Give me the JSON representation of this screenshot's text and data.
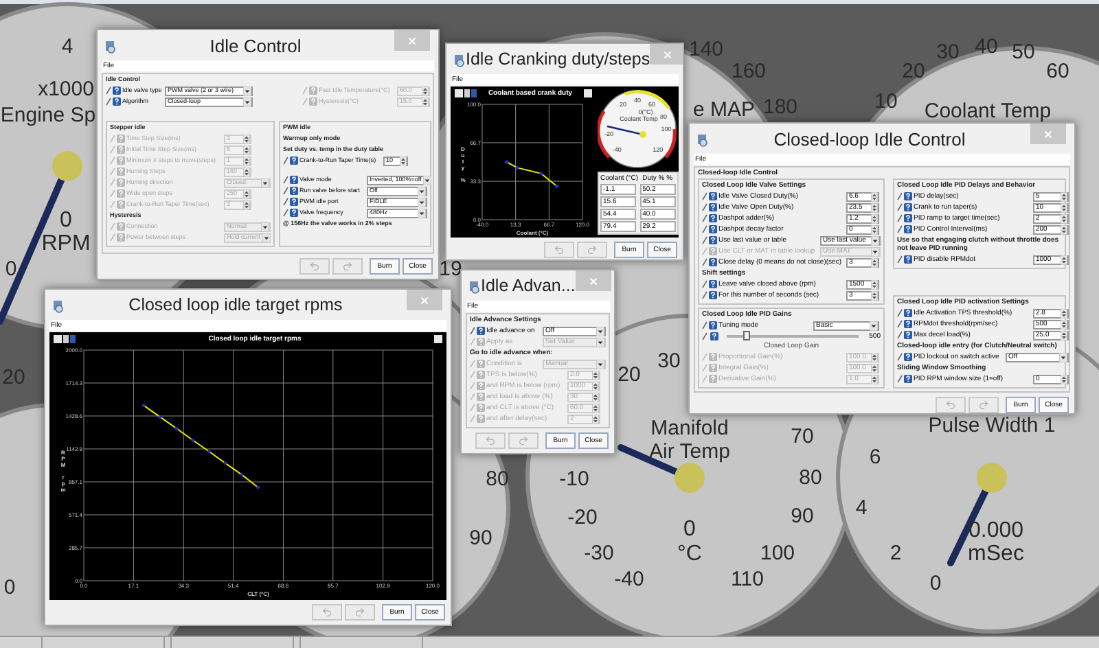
{
  "gauges": [
    {
      "title_lines": [
        "x1000",
        "Engine Sp"
      ],
      "ticks": [
        "4",
        "0"
      ],
      "reading": "0",
      "unit": "RPM"
    },
    {
      "title_lines": [
        "e MAP"
      ],
      "ticks": [
        "140",
        "160",
        "180"
      ]
    },
    {
      "title_lines": [
        "Coolant Temp"
      ],
      "ticks": [
        "10",
        "20",
        "30",
        "40",
        "50",
        "60"
      ]
    },
    {
      "ticks": [
        "19"
      ]
    },
    {
      "ticks": [
        "20",
        "0"
      ]
    },
    {
      "ticks": [
        "80",
        "90"
      ]
    },
    {
      "title_lines": [
        "Manifold",
        "Air Temp"
      ],
      "ticks": [
        "20",
        "30",
        "-10",
        "-20",
        "-30",
        "-40",
        "70",
        "80",
        "90",
        "100",
        "110"
      ],
      "reading": "0",
      "unit": "°C"
    },
    {
      "title_lines": [
        "Pulse Width 1"
      ],
      "ticks": [
        "6",
        "4",
        "2",
        "0"
      ],
      "reading": "0.000",
      "unit": "mSec"
    }
  ],
  "idle_control": {
    "title": "Idle Control",
    "menu": "File",
    "group": "Idle Control",
    "top_left": [
      {
        "kind": "select",
        "label": "Idle valve type",
        "value": "PWM valve (2 or 3 wire)",
        "disabled": false
      },
      {
        "kind": "select",
        "label": "Algorithm",
        "value": "Closed-loop",
        "disabled": false
      }
    ],
    "top_right": [
      {
        "kind": "field",
        "label": "Fast Idle Temperature(°C)",
        "value": "60.0",
        "disabled": true
      },
      {
        "kind": "field",
        "label": "Hysteresis(°C)",
        "value": "15.0",
        "disabled": true
      }
    ],
    "stepper": {
      "title": "Stepper idle",
      "rows": [
        {
          "kind": "field",
          "label": "Time Step Size(ms)",
          "value": "3",
          "disabled": true
        },
        {
          "kind": "field",
          "label": "Initial Time Step Size(ms)",
          "value": "5",
          "disabled": true
        },
        {
          "kind": "field",
          "label": "Minimum # steps to move(steps)",
          "value": "1",
          "disabled": true
        },
        {
          "kind": "field",
          "label": "Homing Steps",
          "value": "160",
          "disabled": true
        },
        {
          "kind": "select",
          "label": "Homing direction",
          "value": "Closed",
          "disabled": true
        },
        {
          "kind": "field",
          "label": "Wide open steps",
          "value": "250",
          "disabled": true
        },
        {
          "kind": "field",
          "label": "Crank-to-Run Taper Time(sec)",
          "value": "3",
          "disabled": true
        },
        {
          "kind": "heading",
          "label": "Hysteresis"
        },
        {
          "kind": "select",
          "label": "Connection",
          "value": "Normal",
          "disabled": true
        },
        {
          "kind": "select",
          "label": "Power between steps",
          "value": "Hold current",
          "disabled": true
        }
      ]
    },
    "pwm": {
      "title": "PWM idle",
      "rows": [
        {
          "kind": "heading",
          "label": "Warmup only mode"
        },
        {
          "kind": "heading",
          "label": "Set duty vs. temp in the duty table"
        },
        {
          "kind": "field",
          "label": "Crank-to-Run Taper Time(s)",
          "value": "10",
          "disabled": false
        },
        {
          "kind": "spacer"
        },
        {
          "kind": "select",
          "label": "Valve mode",
          "value": "Inverted, 100%=off",
          "disabled": false
        },
        {
          "kind": "select",
          "label": "Run valve before start",
          "value": "Off",
          "disabled": false
        },
        {
          "kind": "select",
          "label": "PWM idle port",
          "value": "FIDLE",
          "disabled": false
        },
        {
          "kind": "select",
          "label": "Valve frequency",
          "value": "480Hz",
          "disabled": false
        },
        {
          "kind": "heading",
          "label": "@ 156Hz the valve works in 2% steps"
        }
      ]
    },
    "buttons": [
      "Burn",
      "Close"
    ]
  },
  "idle_cranking": {
    "title": "Idle Cranking duty/steps",
    "menu": "File",
    "chart_data": {
      "type": "line",
      "title": "Coolant based crank duty",
      "xlabel": "Coolant (°C)",
      "ylabel": "Duty %",
      "grid": true,
      "x": [
        -1,
        16,
        54,
        79
      ],
      "series": [
        {
          "color": "#e8e800",
          "values": [
            50,
            45,
            40,
            29
          ]
        }
      ],
      "xlim": [
        -40,
        120
      ],
      "ylim": [
        0,
        100
      ],
      "xticks": [
        {
          "value": -40,
          "label": "-40.0"
        },
        {
          "value": 13.3,
          "label": "13.3"
        },
        {
          "value": 66.7,
          "label": "66.7"
        },
        {
          "value": 120,
          "label": "120.0"
        }
      ],
      "yticks": [
        {
          "value": 0,
          "label": "0.0"
        },
        {
          "value": 33.3,
          "label": "33.3"
        },
        {
          "value": 66.7,
          "label": "66.7"
        },
        {
          "value": 100,
          "label": "100.0"
        }
      ]
    },
    "gauge": {
      "ticks": [
        "-40",
        "-20",
        "20",
        "40",
        "60",
        "80",
        "100",
        "120"
      ],
      "reading": "0(°C)",
      "title": "Coolant Temp"
    },
    "table": {
      "columns": [
        "Coolant (°C)",
        "Duty % %"
      ],
      "rows": [
        [
          "-1.1",
          "50.2"
        ],
        [
          "15.6",
          "45.1"
        ],
        [
          "54.4",
          "40.0"
        ],
        [
          "79.4",
          "29.2"
        ]
      ]
    },
    "buttons": [
      "Burn",
      "Close"
    ]
  },
  "closed_loop": {
    "title": "Closed-loop Idle Control",
    "menu": "File",
    "group": "Closed-loop Idle Control",
    "valve": {
      "title": "Closed Loop Idle Valve Settings",
      "rows": [
        {
          "kind": "field",
          "label": "Idle Valve Closed Duty(%)",
          "value": "6.6",
          "disabled": false
        },
        {
          "kind": "field",
          "label": "Idle Valve Open Duty(%)",
          "value": "23.5",
          "disabled": false
        },
        {
          "kind": "field",
          "label": "Dashpot adder(%)",
          "value": "1.2",
          "disabled": false
        },
        {
          "kind": "field",
          "label": "Dashpot decay factor",
          "value": "0",
          "disabled": false
        },
        {
          "kind": "select",
          "label": "Use last value or table",
          "value": "Use last value",
          "disabled": false
        },
        {
          "kind": "select",
          "label": "Use CLT or MAT in table lookup",
          "value": "Use MAT",
          "disabled": true
        },
        {
          "kind": "field",
          "label": "Close delay (0 means do not close)(sec)",
          "value": "3",
          "disabled": false
        },
        {
          "kind": "heading",
          "label": "Shift settings"
        },
        {
          "kind": "field",
          "label": "Leave valve closed above (rpm)",
          "value": "1500",
          "disabled": false
        },
        {
          "kind": "field",
          "label": "For this number of seconds (sec)",
          "value": "3",
          "disabled": false
        }
      ]
    },
    "gains": {
      "title": "Closed Loop Idle PID Gains",
      "rows": [
        {
          "kind": "select",
          "label": "Tuning mode",
          "value": "Basic",
          "disabled": false
        },
        {
          "kind": "slider",
          "level": 0.15,
          "max_label": "500",
          "caption": "Closed Loop Gain",
          "disabled": false
        },
        {
          "kind": "field",
          "label": "Proportional Gain(%)",
          "value": "100.0",
          "disabled": true
        },
        {
          "kind": "field",
          "label": "Integral Gain(%)",
          "value": "100.0",
          "disabled": true
        },
        {
          "kind": "field",
          "label": "Derivative Gain(%)",
          "value": "1.0",
          "disabled": true
        }
      ]
    },
    "delays": {
      "title": "Closed Loop Idle PID Delays and Behavior",
      "rows": [
        {
          "kind": "field",
          "label": "PID delay(sec)",
          "value": "5",
          "disabled": false
        },
        {
          "kind": "field",
          "label": "Crank to run taper(s)",
          "value": "10",
          "disabled": false
        },
        {
          "kind": "field",
          "label": "PID ramp to target time(sec)",
          "value": "2",
          "disabled": false
        },
        {
          "kind": "field",
          "label": "PID Control Interval(ms)",
          "value": "200",
          "disabled": false
        },
        {
          "kind": "heading",
          "label": "Use so that engaging clutch without throttle does not leave PID running"
        },
        {
          "kind": "field",
          "label": "PID disable RPMdot",
          "value": "1000",
          "disabled": false
        }
      ]
    },
    "activation": {
      "title": "Closed Loop Idle PID activation Settings",
      "rows": [
        {
          "kind": "field",
          "label": "Idle Activation TPS threshold(%)",
          "value": "2.8",
          "disabled": false
        },
        {
          "kind": "field",
          "label": "RPMdot threshold(rpm/sec)",
          "value": "500",
          "disabled": false
        },
        {
          "kind": "field",
          "label": "Max decel load(%)",
          "value": "25.0",
          "disabled": false
        },
        {
          "kind": "heading",
          "label": "Closed-loop idle entry (for Clutch/Neutral switch)"
        },
        {
          "kind": "select",
          "label": "PID lockout on switch active",
          "value": "Off",
          "disabled": false
        },
        {
          "kind": "heading",
          "label": "Sliding Window Smoothing"
        },
        {
          "kind": "field",
          "label": "PID RPM window size (1=off)",
          "value": "0",
          "disabled": false
        }
      ]
    },
    "buttons": [
      "Burn",
      "Close"
    ]
  },
  "target_rpms": {
    "title": "Closed loop idle target rpms",
    "menu": "File",
    "chart_data": {
      "type": "line",
      "title": "Closed loop idle target rpms",
      "xlabel": "CLT (°C)",
      "ylabel": "RPM rpm",
      "grid": true,
      "x": [
        20.6,
        26.2,
        31.9,
        37.4,
        43.1,
        48.6,
        54.3,
        59.9
      ],
      "series": [
        {
          "color": "#e8e800",
          "values": [
            1520,
            1420,
            1320,
            1220,
            1120,
            1020,
            920,
            810
          ]
        }
      ],
      "xlim": [
        0,
        120
      ],
      "ylim": [
        0,
        2000
      ],
      "xticks": [
        {
          "value": 0,
          "label": "0.0"
        },
        {
          "value": 17.1,
          "label": "17.1"
        },
        {
          "value": 34.3,
          "label": "34.3"
        },
        {
          "value": 51.4,
          "label": "51.4"
        },
        {
          "value": 68.6,
          "label": "68.6"
        },
        {
          "value": 85.7,
          "label": "85.7"
        },
        {
          "value": 102.9,
          "label": "102.9"
        },
        {
          "value": 120,
          "label": "120.0"
        }
      ],
      "yticks": [
        {
          "value": 0,
          "label": "0.0"
        },
        {
          "value": 285.7,
          "label": "285.7"
        },
        {
          "value": 571.4,
          "label": "571.4"
        },
        {
          "value": 857.1,
          "label": "857.1"
        },
        {
          "value": 1142.9,
          "label": "1142.9"
        },
        {
          "value": 1428.6,
          "label": "1428.6"
        },
        {
          "value": 1714.3,
          "label": "1714.3"
        },
        {
          "value": 2000,
          "label": "2000.0"
        }
      ]
    },
    "buttons": [
      "Burn",
      "Close"
    ]
  },
  "idle_advance": {
    "title": "Idle Advan...",
    "menu": "File",
    "group": "Idle Advance Settings",
    "rows": [
      {
        "kind": "select",
        "label": "Idle advance on",
        "value": "Off",
        "disabled": false
      },
      {
        "kind": "select",
        "label": "Apply as",
        "value": "Set Value",
        "disabled": true
      },
      {
        "kind": "heading",
        "label": "Go to idle advance when:"
      },
      {
        "kind": "select",
        "label": "Condition is",
        "value": "Manual",
        "disabled": true
      },
      {
        "kind": "field",
        "label": "TPS is below(%)",
        "value": "2.0",
        "disabled": true
      },
      {
        "kind": "field",
        "label": "and RPM is below (rpm)",
        "value": "1000",
        "disabled": true
      },
      {
        "kind": "field",
        "label": "and load is above (%)",
        "value": "30",
        "disabled": true
      },
      {
        "kind": "field",
        "label": "and CLT is above (°C)",
        "value": "60.0",
        "disabled": true
      },
      {
        "kind": "field",
        "label": "and after delay(sec)",
        "value": "2",
        "disabled": true
      }
    ],
    "buttons": [
      "Burn",
      "Close"
    ]
  }
}
